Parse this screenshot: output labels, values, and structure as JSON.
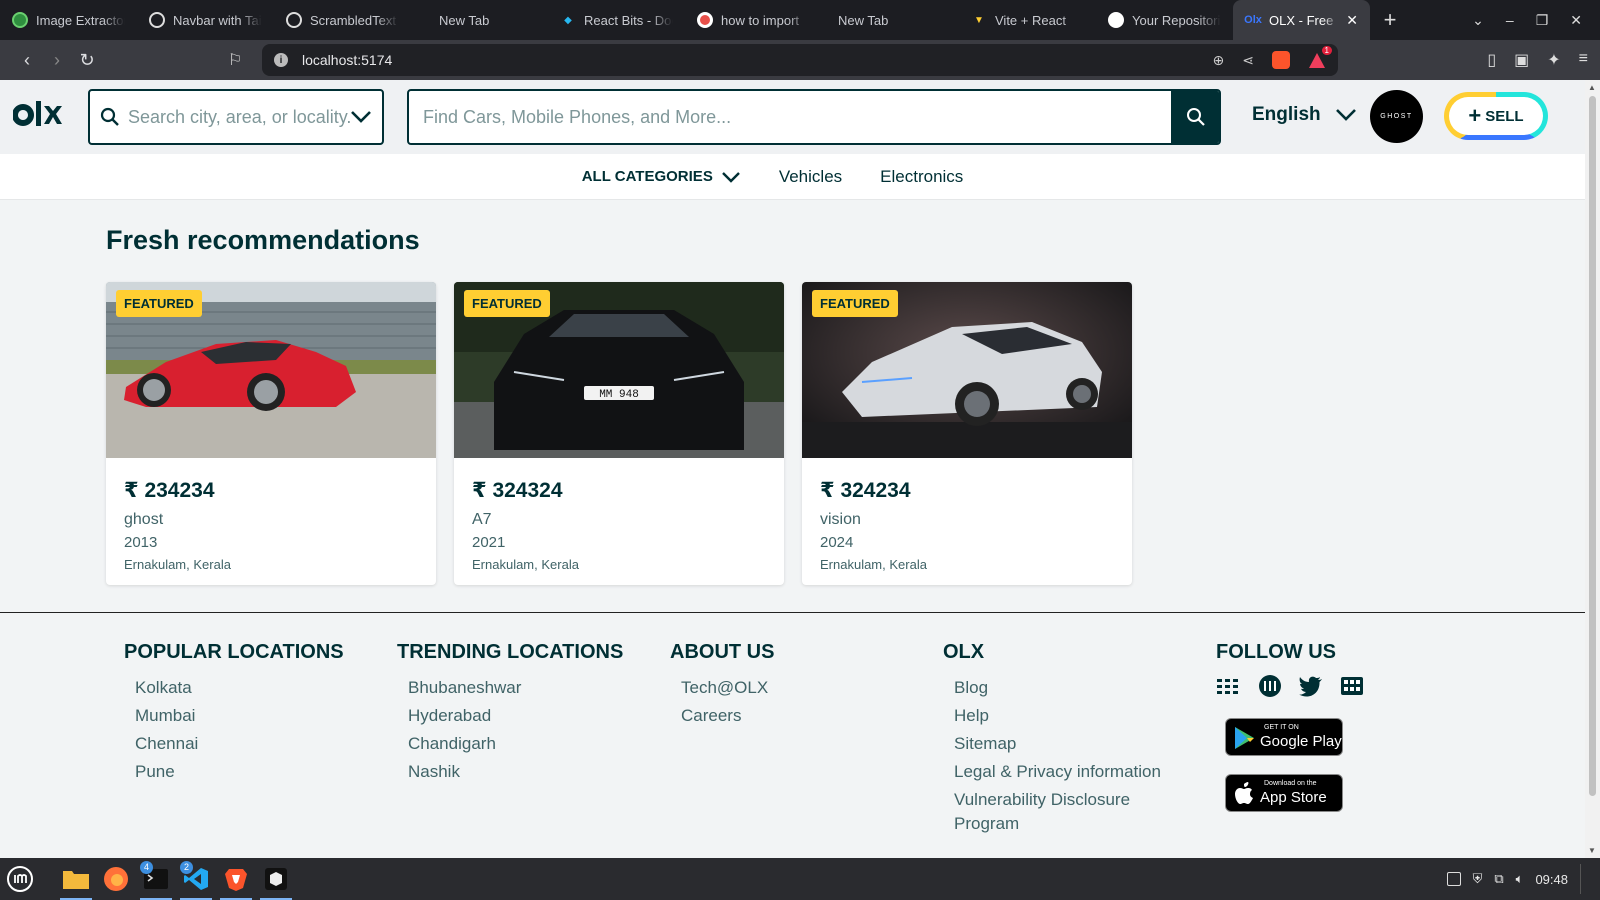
{
  "browser": {
    "tabs": [
      {
        "label": "Image Extractor",
        "icon": "globe-icon",
        "color": "#2f8f3f"
      },
      {
        "label": "Navbar with Tai",
        "icon": "chatgpt-icon",
        "color": "#ffffff"
      },
      {
        "label": "ScrambledText",
        "icon": "chatgpt-icon",
        "color": "#ffffff"
      },
      {
        "label": "New Tab",
        "icon": "",
        "color": ""
      },
      {
        "label": "React Bits - Doc",
        "icon": "react-bits-icon",
        "color": "#27b8f0"
      },
      {
        "label": "how to import",
        "icon": "perplexity-icon",
        "color": "#e8504a"
      },
      {
        "label": "New Tab",
        "icon": "",
        "color": ""
      },
      {
        "label": "Vite + React",
        "icon": "vite-icon",
        "color": "#a259ff"
      },
      {
        "label": "Your Repositori",
        "icon": "github-icon",
        "color": "#ffffff"
      },
      {
        "label": "OLX - Free",
        "icon": "olx-icon",
        "color": "#3a77ff",
        "active": true
      }
    ],
    "url": "localhost:5174"
  },
  "header": {
    "location_placeholder": "Search city, area, or locality...",
    "search_placeholder": "Find Cars, Mobile Phones, and More...",
    "language": "English",
    "avatar_text": "GHOST",
    "sell_label": "SELL"
  },
  "categories": {
    "all_label": "ALL CATEGORIES",
    "links": [
      "Vehicles",
      "Electronics"
    ]
  },
  "section_title": "Fresh recommendations",
  "listings": [
    {
      "badge": "FEATURED",
      "price": "₹ 234234",
      "title": "ghost",
      "year": "2013",
      "location": "Ernakulam, Kerala",
      "car_color": "#d8202f"
    },
    {
      "badge": "FEATURED",
      "price": "₹ 324324",
      "title": "A7",
      "year": "2021",
      "location": "Ernakulam, Kerala",
      "plate": "MM 948",
      "car_color": "#111214"
    },
    {
      "badge": "FEATURED",
      "price": "₹ 324234",
      "title": "vision",
      "year": "2024",
      "location": "Ernakulam, Kerala",
      "car_color": "#d6d9dd"
    }
  ],
  "footer": {
    "popular": {
      "title": "POPULAR LOCATIONS",
      "items": [
        "Kolkata",
        "Mumbai",
        "Chennai",
        "Pune"
      ]
    },
    "trending": {
      "title": "TRENDING LOCATIONS",
      "items": [
        "Bhubaneshwar",
        "Hyderabad",
        "Chandigarh",
        "Nashik"
      ]
    },
    "about": {
      "title": "ABOUT US",
      "items": [
        "Tech@OLX",
        "Careers"
      ]
    },
    "olx": {
      "title": "OLX",
      "items": [
        "Blog",
        "Help",
        "Sitemap",
        "Legal & Privacy information",
        "Vulnerability Disclosure Program"
      ]
    },
    "follow": {
      "title": "FOLLOW US",
      "icons": [
        "facebook-icon",
        "instagram-icon",
        "twitter-icon",
        "youtube-icon"
      ],
      "google_play": {
        "small": "GET IT ON",
        "big": "Google Play"
      },
      "app_store": {
        "small": "Download on the",
        "big": "App Store"
      }
    }
  },
  "taskbar": {
    "badges": {
      "terminal": "4",
      "vscode": "2"
    },
    "clock": "09:48"
  }
}
